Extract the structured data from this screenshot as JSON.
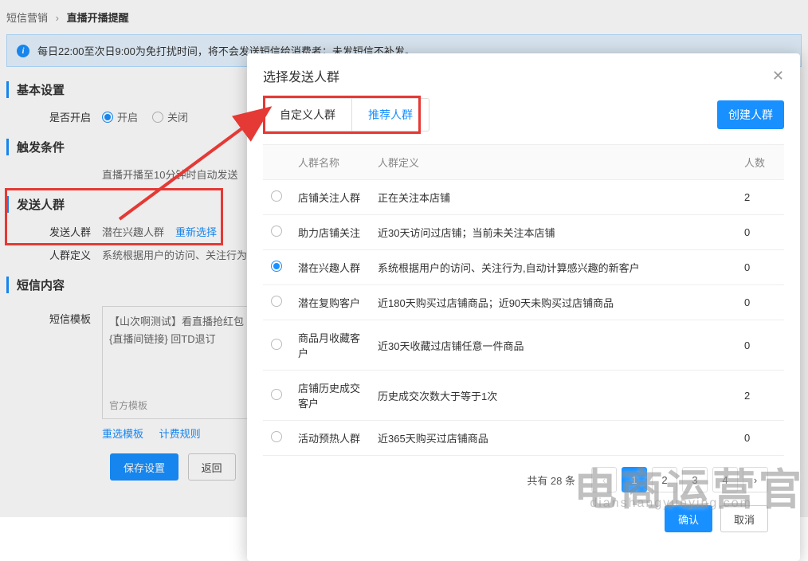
{
  "breadcrumb": {
    "root": "短信营销",
    "current": "直播开播提醒"
  },
  "info": {
    "text": "每日22:00至次日9:00为免打扰时间，将不会发送短信给消费者；未发短信不补发。"
  },
  "sections": {
    "basic": {
      "title": "基本设置",
      "enable_label": "是否开启",
      "on": "开启",
      "off": "关闭"
    },
    "trigger": {
      "title": "触发条件",
      "label": "",
      "desc": "直播开播至10分钟时自动发送"
    },
    "audience": {
      "title": "发送人群",
      "label": "发送人群",
      "value": "潜在兴趣人群",
      "reselect": "重新选择",
      "def_label": "人群定义",
      "def_value": "系统根据用户的访问、关注行为"
    },
    "sms": {
      "title": "短信内容",
      "template_label": "短信模板",
      "template_text": "【山次啊测试】看直播抢红包\n{直播间链接} 回TD退订",
      "official": "官方模板",
      "reselect_tpl": "重选模板",
      "billing": "计费规则"
    }
  },
  "actions": {
    "save": "保存设置",
    "back": "返回"
  },
  "modal": {
    "title": "选择发送人群",
    "tab_custom": "自定义人群",
    "tab_recommend": "推荐人群",
    "create": "创建人群",
    "col_name": "人群名称",
    "col_def": "人群定义",
    "col_count": "人数",
    "rows": [
      {
        "selected": false,
        "name": "店铺关注人群",
        "def": "正在关注本店铺",
        "count": "2"
      },
      {
        "selected": false,
        "name": "助力店铺关注",
        "def": "近30天访问过店铺；当前未关注本店铺",
        "count": "0"
      },
      {
        "selected": true,
        "name": "潜在兴趣人群",
        "def": "系统根据用户的访问、关注行为,自动计算感兴趣的新客户",
        "count": "0"
      },
      {
        "selected": false,
        "name": "潜在复购客户",
        "def": "近180天购买过店铺商品；近90天未购买过店铺商品",
        "count": "0"
      },
      {
        "selected": false,
        "name": "商品月收藏客户",
        "def": "近30天收藏过店铺任意一件商品",
        "count": "0"
      },
      {
        "selected": false,
        "name": "店铺历史成交客户",
        "def": "历史成交次数大于等于1次",
        "count": "2"
      },
      {
        "selected": false,
        "name": "活动预热人群",
        "def": "近365天购买过店铺商品",
        "count": "0"
      }
    ],
    "page_info": "共有 28 条",
    "pages": [
      "1",
      "2",
      "3",
      "4"
    ],
    "ok": "确认",
    "cancel": "取消"
  },
  "watermark": {
    "main": "电商运营官",
    "sub": "dianshangyunying.com"
  }
}
